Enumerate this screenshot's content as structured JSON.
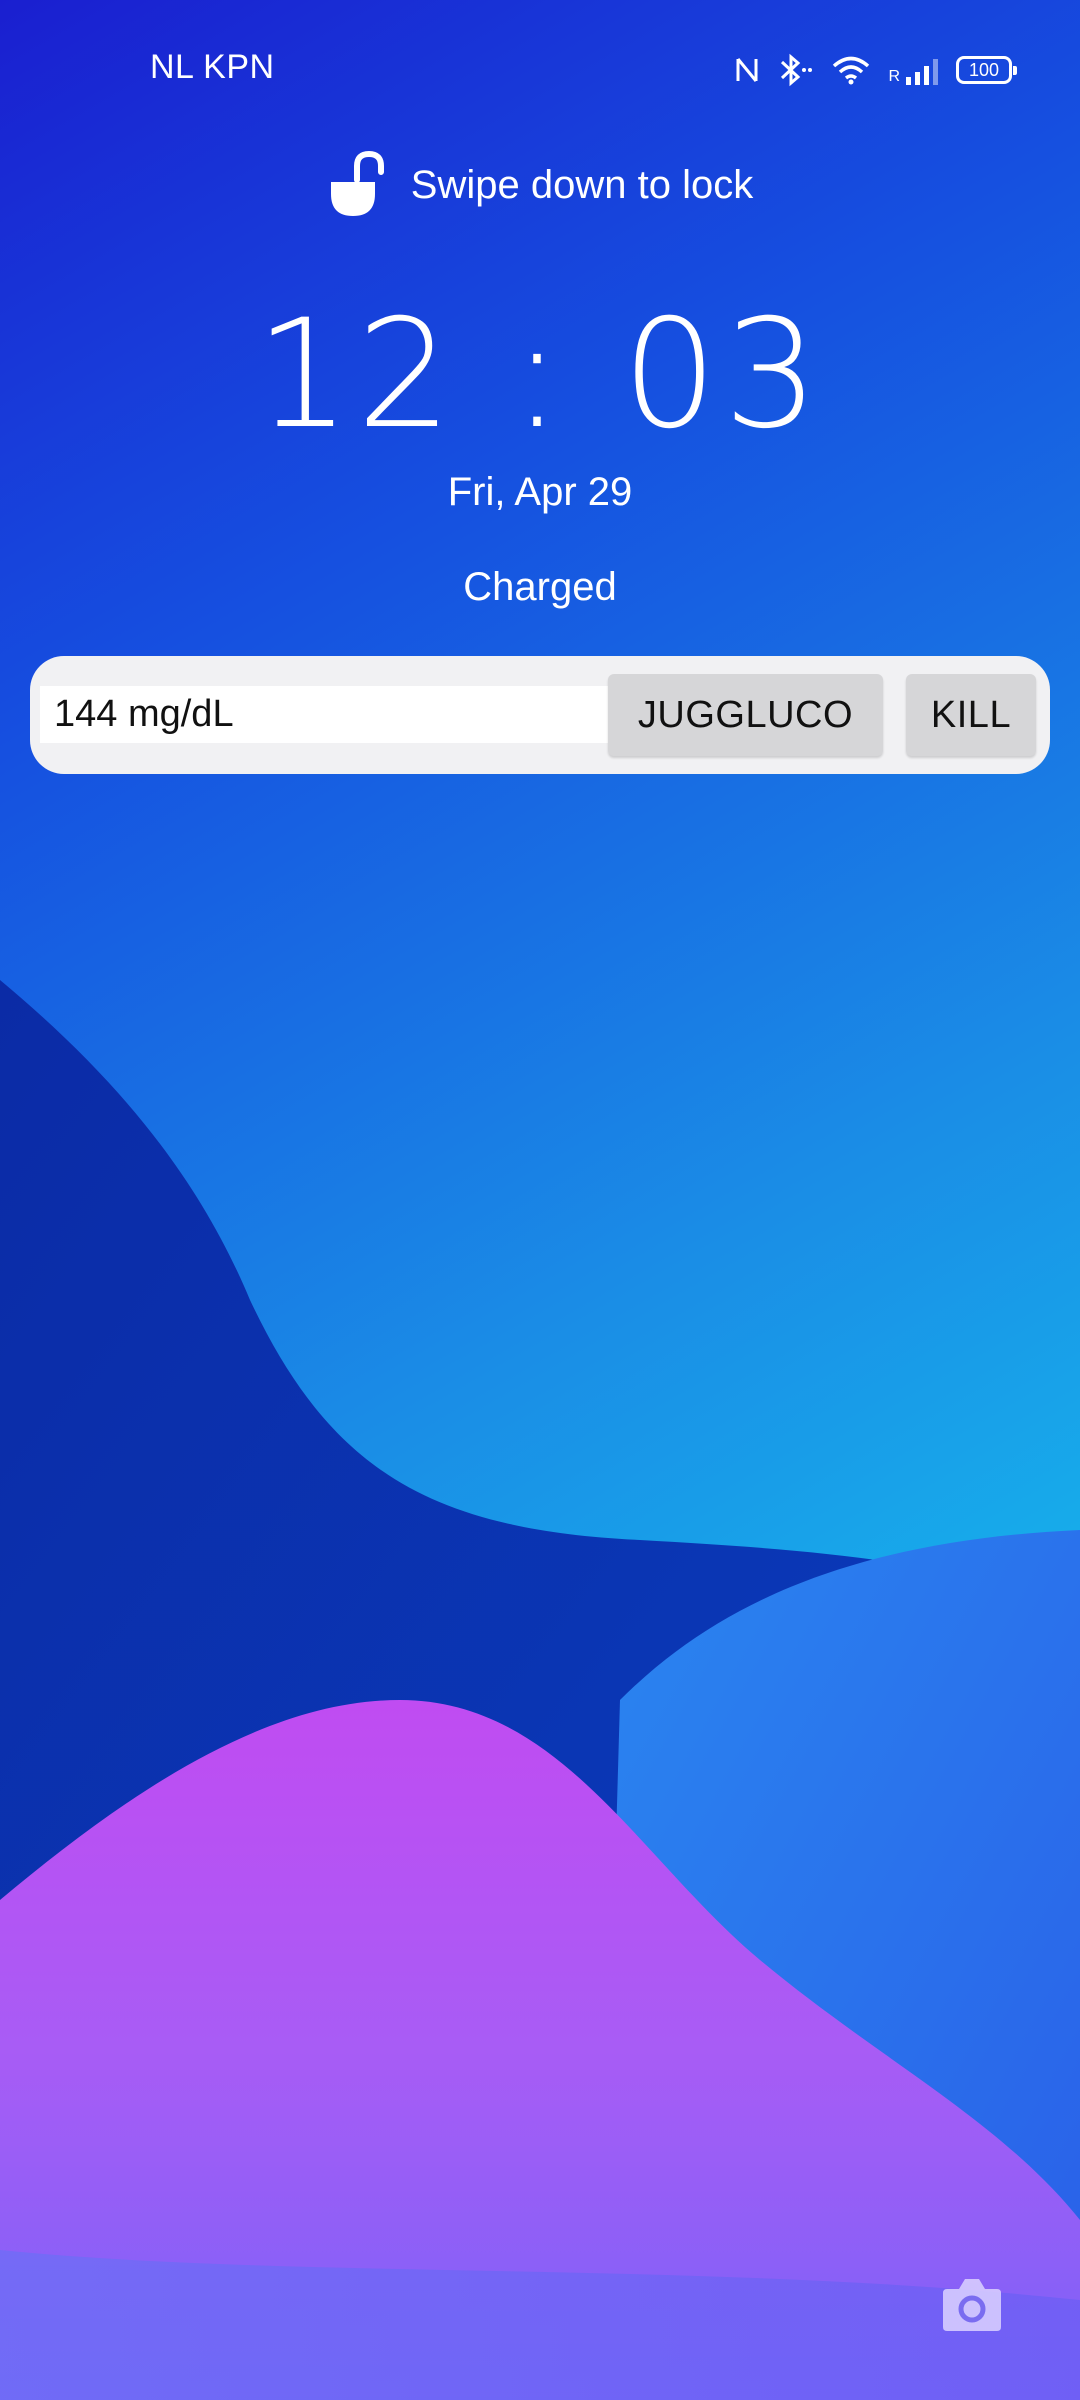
{
  "status_bar": {
    "carrier": "NL KPN",
    "icons": [
      "nfc-icon",
      "bluetooth-icon",
      "wifi-icon",
      "signal-icon"
    ],
    "roaming_indicator": "R",
    "battery_level": "100"
  },
  "lock_hint": {
    "icon": "unlock-icon",
    "text": "Swipe down to lock"
  },
  "clock": {
    "time": "12 : 03",
    "date": "Fri, Apr 29",
    "charging_status": "Charged"
  },
  "widget": {
    "glucose_value": "144 mg/dL",
    "juggluco_label": "JUGGLUCO",
    "kill_label": "KILL"
  },
  "shortcuts": {
    "camera_icon": "camera-icon"
  },
  "colors": {
    "wallpaper_top": "#1a1fd0",
    "wallpaper_cyan": "#14c4ee",
    "wave_dark": "#0a2a9a",
    "wave_purple": "#a855f7",
    "widget_bg": "#f1f1f3",
    "button_bg": "#d6d6d8"
  }
}
